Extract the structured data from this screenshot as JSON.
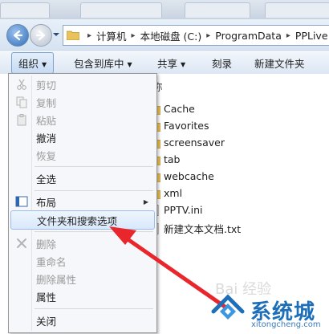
{
  "address": {
    "crumbs": [
      "计算机",
      "本地磁盘 (C:)",
      "ProgramData",
      "PPLive"
    ]
  },
  "toolbar": {
    "organize": "组织",
    "include_library": "包含到库中",
    "share": "共享",
    "burn": "刻录",
    "new_folder": "新建文件夹"
  },
  "file_list": {
    "column_name": "称",
    "items": [
      "Cache",
      "Favorites",
      "screensaver",
      "tab",
      "webcache",
      "xml",
      "PPTV.ini",
      "新建文本文档.txt"
    ]
  },
  "context_menu": {
    "items": [
      {
        "label": "剪切",
        "enabled": false
      },
      {
        "label": "复制",
        "enabled": false
      },
      {
        "label": "粘贴",
        "enabled": false
      },
      {
        "label": "撤消",
        "enabled": true
      },
      {
        "label": "恢复",
        "enabled": false
      },
      {
        "label": "全选",
        "enabled": true
      },
      {
        "label": "布局",
        "enabled": true
      },
      {
        "label": "文件夹和搜索选项",
        "enabled": true
      },
      {
        "label": "删除",
        "enabled": false
      },
      {
        "label": "重命名",
        "enabled": false
      },
      {
        "label": "删除属性",
        "enabled": false
      },
      {
        "label": "属性",
        "enabled": true
      },
      {
        "label": "关闭",
        "enabled": true
      }
    ]
  },
  "watermark": {
    "brand": "系统城",
    "url": "xitongcheng.com",
    "faint_text": "Bai  经验"
  },
  "colors": {
    "highlight_border": "#9dbde6",
    "annotation_arrow": "#e8262c",
    "brand_blue": "#1e6fb8"
  }
}
